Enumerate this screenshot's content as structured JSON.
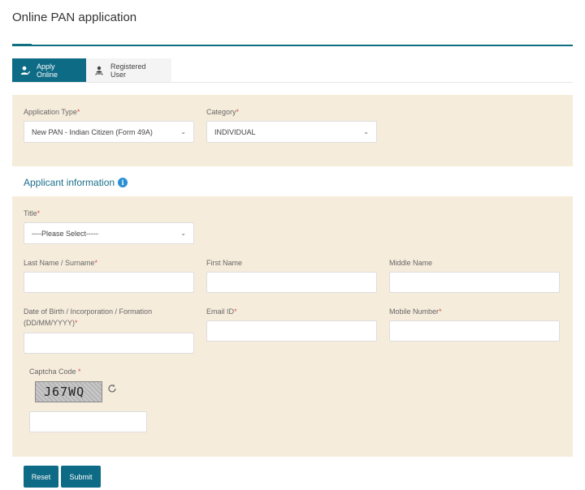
{
  "header": {
    "title": "Online PAN application"
  },
  "tabs": [
    {
      "label": "Apply Online",
      "icon": "user-edit-icon",
      "active": true
    },
    {
      "label": "Registered User",
      "icon": "user-network-icon",
      "active": false
    }
  ],
  "application": {
    "type_label": "Application Type",
    "type_value": "New PAN - Indian Citizen (Form 49A)",
    "category_label": "Category",
    "category_value": "INDIVIDUAL",
    "required_mark": "*"
  },
  "applicant": {
    "heading": "Applicant information",
    "info_glyph": "i",
    "title_label": "Title",
    "title_value": "----Please Select-----",
    "last_name_label": "Last Name / Surname",
    "first_name_label": "First Name",
    "middle_name_label": "Middle Name",
    "dob_label_line1": "Date of Birth / Incorporation / Formation",
    "dob_label_line2": "(DD/MM/YYYY)",
    "email_label": "Email ID",
    "mobile_label": "Mobile Number",
    "last_name_value": "",
    "first_name_value": "",
    "middle_name_value": "",
    "dob_value": "",
    "email_value": "",
    "mobile_value": ""
  },
  "captcha": {
    "label": "Captcha Code ",
    "text": "J67WQ",
    "input_value": ""
  },
  "actions": {
    "reset_label": "Reset",
    "submit_label": "Submit"
  },
  "colors": {
    "accent": "#0e6b85",
    "panel_bg": "#f6ecdc",
    "required": "#d9534f",
    "info": "#2b8fd6"
  }
}
